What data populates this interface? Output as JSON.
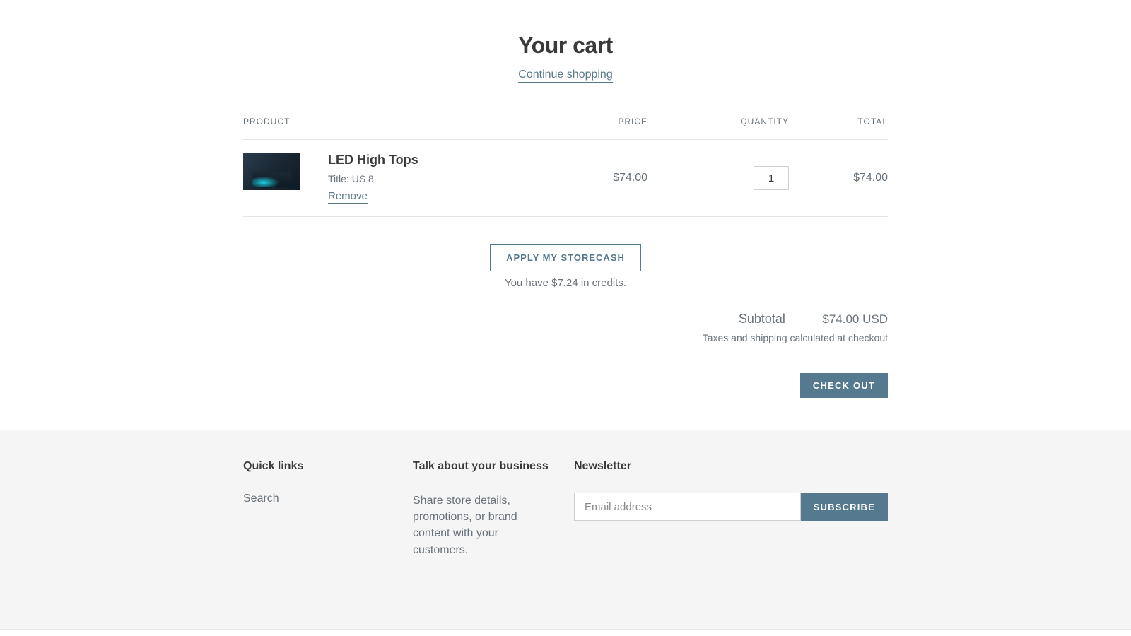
{
  "header": {
    "title": "Your cart",
    "continue_label": "Continue shopping"
  },
  "columns": {
    "product": "PRODUCT",
    "price": "PRICE",
    "quantity": "QUANTITY",
    "total": "TOTAL"
  },
  "item": {
    "name": "LED High Tops",
    "variant": "Title: US 8",
    "remove_label": "Remove",
    "price": "$74.00",
    "quantity": "1",
    "line_total": "$74.00"
  },
  "storecash": {
    "button_label": "APPLY MY STORECASH",
    "credit_note": "You have $7.24 in credits."
  },
  "summary": {
    "subtotal_label": "Subtotal",
    "subtotal_value": "$74.00 USD",
    "tax_note": "Taxes and shipping calculated at checkout",
    "checkout_label": "CHECK OUT"
  },
  "footer": {
    "quick_links_heading": "Quick links",
    "search_label": "Search",
    "business_heading": "Talk about your business",
    "business_text": "Share store details, promotions, or brand content with your customers.",
    "newsletter_heading": "Newsletter",
    "email_placeholder": "Email address",
    "subscribe_label": "SUBSCRIBE"
  }
}
